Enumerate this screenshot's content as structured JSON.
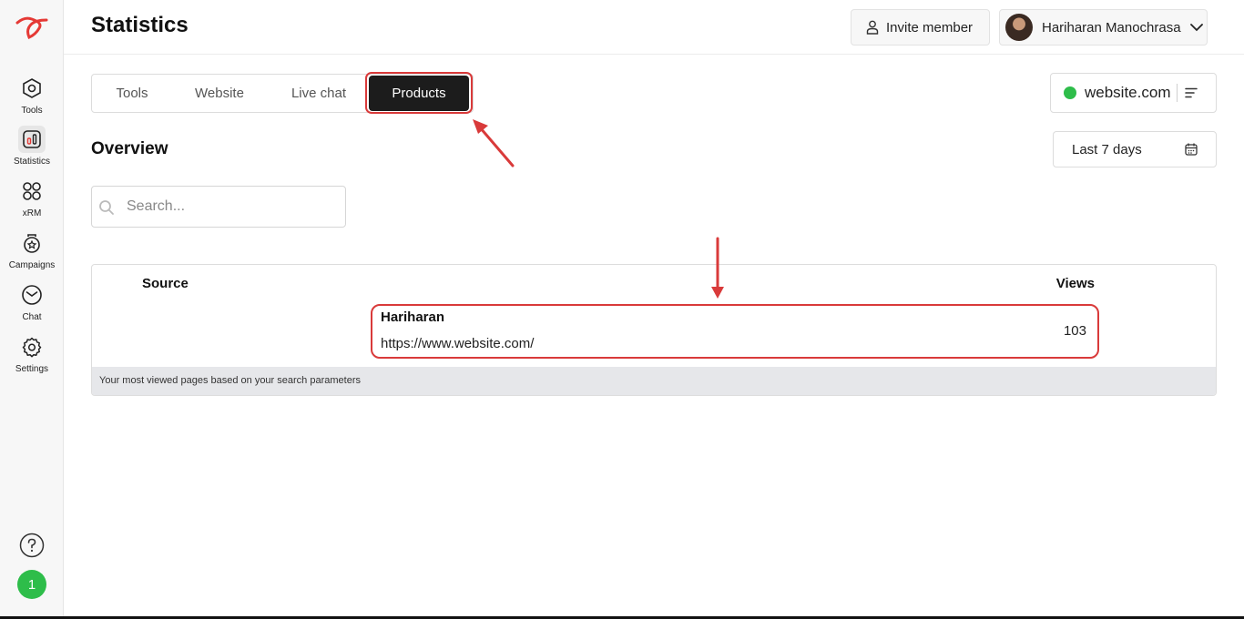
{
  "sidebar": {
    "logo": "brand-logo-icon",
    "items": [
      {
        "label": "Tools",
        "icon": "hexagon-gear-icon",
        "active": false
      },
      {
        "label": "Statistics",
        "icon": "bar-chart-icon",
        "active": true
      },
      {
        "label": "xRM",
        "icon": "grid-icon",
        "active": false
      },
      {
        "label": "Campaigns",
        "icon": "badge-star-icon",
        "active": false
      },
      {
        "label": "Chat",
        "icon": "chat-bubble-icon",
        "active": false
      },
      {
        "label": "Settings",
        "icon": "gear-icon",
        "active": false
      }
    ],
    "help_icon": "question-circle-icon",
    "notification_count": "1"
  },
  "header": {
    "title": "Statistics",
    "invite_label": "Invite member",
    "user_name": "Hariharan Manochrasa"
  },
  "tabs": [
    {
      "label": "Tools"
    },
    {
      "label": "Website"
    },
    {
      "label": "Live chat"
    },
    {
      "label": "Products",
      "active": true
    }
  ],
  "site_selector": {
    "label": "website.com",
    "status_color": "#2ebd4a"
  },
  "overview": {
    "title": "Overview",
    "date_range": "Last 7 days",
    "search_placeholder": "Search..."
  },
  "table": {
    "columns": [
      "Source",
      "Views"
    ],
    "rows": [
      {
        "title": "Hariharan",
        "url": "https://www.website.com/",
        "views": "103"
      }
    ],
    "footer": "Your most viewed pages based on your search parameters"
  },
  "colors": {
    "accent": "#1c1c1c",
    "highlight": "#d93a3a",
    "online": "#2ebd4a"
  }
}
